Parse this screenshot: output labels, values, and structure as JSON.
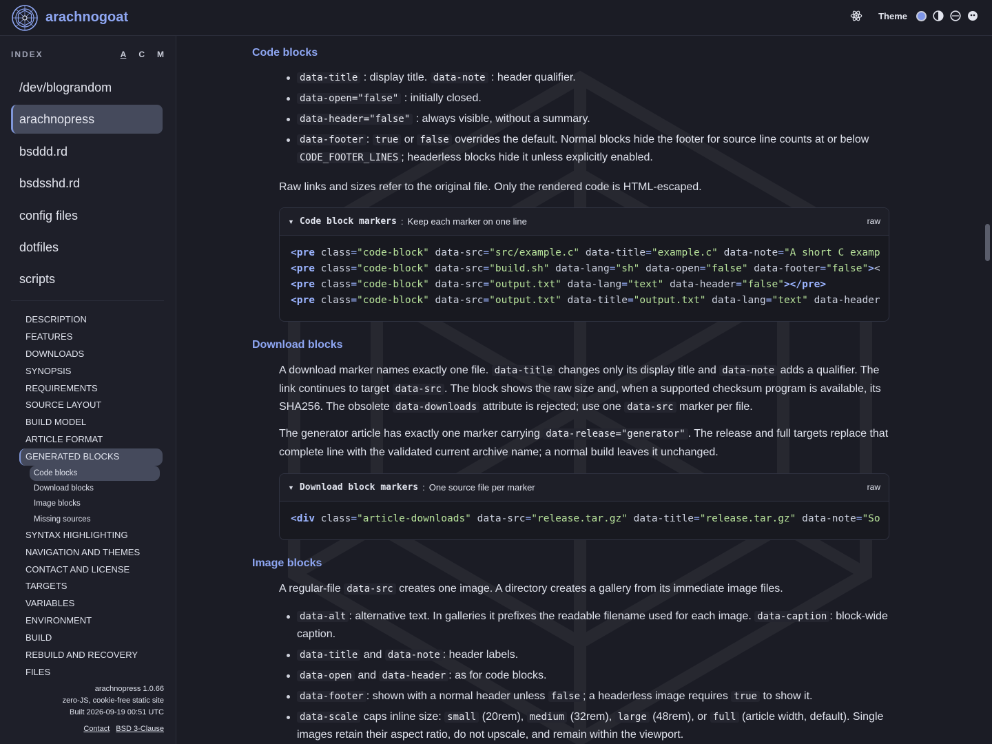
{
  "app": {
    "name": "arachnogoat"
  },
  "header": {
    "theme_label": "Theme"
  },
  "sidebar": {
    "index_label": "INDEX",
    "sort_options": [
      "A",
      "C",
      "M"
    ],
    "articles": [
      "/dev/blograndom",
      "arachnopress",
      "bsddd.rd",
      "bsdsshd.rd",
      "config files",
      "dotfiles",
      "scripts"
    ],
    "active_article": "arachnopress",
    "toc": [
      "DESCRIPTION",
      "FEATURES",
      "DOWNLOADS",
      "SYNOPSIS",
      "REQUIREMENTS",
      "SOURCE LAYOUT",
      "BUILD MODEL",
      "ARTICLE FORMAT",
      "GENERATED BLOCKS"
    ],
    "toc_sub": [
      "Code blocks",
      "Download blocks",
      "Image blocks",
      "Missing sources"
    ],
    "toc_rest": [
      "SYNTAX HIGHLIGHTING",
      "NAVIGATION AND THEMES",
      "CONTACT AND LICENSE",
      "TARGETS",
      "VARIABLES",
      "ENVIRONMENT",
      "BUILD",
      "REBUILD AND RECOVERY",
      "FILES"
    ],
    "footer": {
      "version": "arachnopress 1.0.66",
      "tagline": "zero-JS, cookie-free static site",
      "built": "Built 2026-09-19 00:51 UTC",
      "contact": "Contact",
      "license": "BSD 3-Clause"
    }
  },
  "content": {
    "code_blocks": {
      "heading": "Code blocks",
      "b1_code1": "data-title",
      "b1_text1": ": display title.",
      "b1_code2": "data-note",
      "b1_text2": ": header qualifier.",
      "b2_code": "data-open=\"false\"",
      "b2_text": ": initially closed.",
      "b3_code": "data-header=\"false\"",
      "b3_text": ": always visible, without a summary.",
      "b4_code1": "data-footer",
      "b4_text1": ":",
      "b4_code2": "true",
      "b4_text2": "or",
      "b4_code3": "false",
      "b4_text3": "overrides the default. Normal blocks hide the footer for source line counts at or below",
      "b4_code4": "CODE_FOOTER_LINES",
      "b4_text4": "; headerless blocks hide it unless explicitly enabled.",
      "para": "Raw links and sizes refer to the original file. Only the rendered code is HTML-escaped.",
      "block_title": "Code block markers",
      "block_note": "Keep each marker on one line",
      "raw_label": "raw",
      "lines": [
        "<pre class=\"code-block\" data-src=\"src/example.c\" data-title=\"example.c\" data-note=\"A short C examp",
        "<pre class=\"code-block\" data-src=\"build.sh\" data-lang=\"sh\" data-open=\"false\" data-footer=\"false\"><",
        "<pre class=\"code-block\" data-src=\"output.txt\" data-lang=\"text\" data-header=\"false\"></pre>",
        "<pre class=\"code-block\" data-src=\"output.txt\" data-title=\"output.txt\" data-lang=\"text\" data-header"
      ]
    },
    "download_blocks": {
      "heading": "Download blocks",
      "p1_t1": "A download marker names exactly one file.",
      "p1_c1": "data-title",
      "p1_t2": "changes only its display title and",
      "p1_c2": "data-note",
      "p1_t3": "adds a qualifier. The link continues to target",
      "p1_c3": "data-src",
      "p1_t4": ". The block shows the raw size and, when a supported checksum program is available, its SHA256. The obsolete",
      "p1_c4": "data-downloads",
      "p1_t5": "attribute is rejected; use one",
      "p1_c5": "data-src",
      "p1_t6": "marker per file.",
      "p2_t1": "The generator article has exactly one marker carrying",
      "p2_c1": "data-release=\"generator\"",
      "p2_t2": ". The release and full targets replace that complete line with the validated current archive name; a normal build leaves it unchanged.",
      "block_title": "Download block markers",
      "block_note": "One source file per marker",
      "raw_label": "raw",
      "lines": [
        "<div class=\"article-downloads\" data-src=\"release.tar.gz\" data-title=\"release.tar.gz\" data-note=\"So"
      ]
    },
    "image_blocks": {
      "heading": "Image blocks",
      "p_t1": "A regular-file",
      "p_c1": "data-src",
      "p_t2": "creates one image. A directory creates a gallery from its immediate image files.",
      "i1_c1": "data-alt",
      "i1_t1": ": alternative text. In galleries it prefixes the readable filename used for each image.",
      "i1_c2": "data-caption",
      "i1_t2": ": block-wide caption.",
      "i2_c1": "data-title",
      "i2_t1": "and",
      "i2_c2": "data-note",
      "i2_t2": ": header labels.",
      "i3_c1": "data-open",
      "i3_t1": "and",
      "i3_c2": "data-header",
      "i3_t2": ": as for code blocks.",
      "i4_c1": "data-footer",
      "i4_t1": ": shown with a normal header unless",
      "i4_c2": "false",
      "i4_t2": "; a headerless image requires",
      "i4_c3": "true",
      "i4_t3": "to show it.",
      "i5_c1": "data-scale",
      "i5_t1": "caps inline size:",
      "i5_c2": "small",
      "i5_t2": "(20rem),",
      "i5_c3": "medium",
      "i5_t3": "(32rem),",
      "i5_c4": "large",
      "i5_t4": "(48rem), or",
      "i5_c5": "full",
      "i5_t5": "(article width, default). Single images retain their aspect ratio, do not upscale, and remain within the viewport."
    }
  },
  "colors": {
    "accent": "#8ea6f2",
    "background": "#1b1c25",
    "sidebar": "#1e1f29",
    "active": "#454a5c"
  }
}
